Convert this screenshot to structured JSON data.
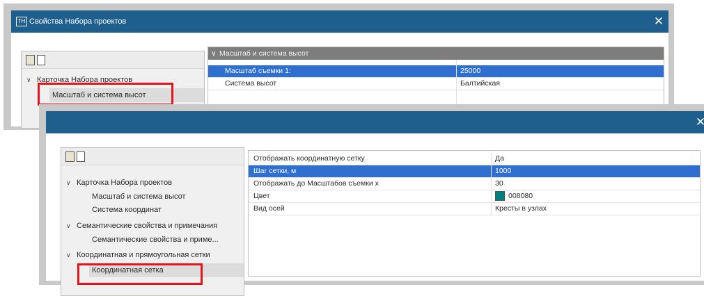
{
  "back_window": {
    "title": "Свойства Набора проектов",
    "icon_text": "TH",
    "close": "✕",
    "tree": {
      "root": "Карточка Набора проектов",
      "selected_item": "Масштаб и система высот"
    },
    "grid": {
      "category": "Масштаб и система высот",
      "rows": [
        {
          "name": "Масштаб съемки 1:",
          "value": "25000",
          "selected": true
        },
        {
          "name": "Система высот",
          "value": "Балтийская",
          "selected": false
        }
      ]
    }
  },
  "front_window": {
    "close": "✕",
    "tree": {
      "items": [
        {
          "label": "Карточка Набора проектов",
          "chevron": "∨"
        },
        {
          "label": "Масштаб и система высот"
        },
        {
          "label": "Система координат"
        },
        {
          "label": "Семантические свойства и примечания",
          "chevron": "∨"
        },
        {
          "label": "Семантические свойства и приме..."
        },
        {
          "label": "Координатная и прямоугольная сетки",
          "chevron": "∨"
        },
        {
          "label": "Координатная сетка"
        }
      ]
    },
    "grid": {
      "rows": [
        {
          "name": "Отображать координатную сетку",
          "value": "Да"
        },
        {
          "name": "Шаг сетки, м",
          "value": "1000"
        },
        {
          "name": "Отображать до Масштабов съемки х",
          "value": "30"
        },
        {
          "name": "Цвет",
          "value": "008080",
          "color": "#008080"
        },
        {
          "name": "Вид осей",
          "value": "Кресты в узлах"
        }
      ]
    }
  },
  "colors": {
    "titlebar": "#1f5f8e",
    "selection": "#2f6fd0",
    "highlight_box": "#e8131b"
  }
}
